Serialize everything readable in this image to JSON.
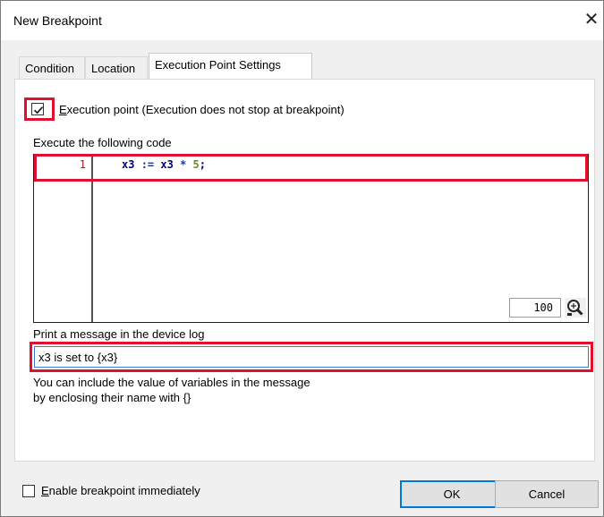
{
  "window": {
    "title": "New Breakpoint",
    "close_glyph": "✕"
  },
  "tabs": [
    {
      "label": "Condition",
      "active": false
    },
    {
      "label": "Location",
      "active": false
    },
    {
      "label": "Execution Point Settings",
      "active": true
    }
  ],
  "execution_point": {
    "checked": true,
    "label_first": "E",
    "label_rest": "xecution point (Execution does not stop at breakpoint)"
  },
  "code_section": {
    "label": "Execute the following code",
    "line_number": "1",
    "code_var": "x3",
    "code_op": ":=",
    "code_expr": "x3",
    "code_mul": "*",
    "code_num": "5",
    "code_end": ";",
    "zoom_value": "100",
    "zoom_icon": "magnifier-icon"
  },
  "log_section": {
    "label": "Print a message in the device log",
    "value": "x3 is set to {x3}",
    "hint_line1": "You can include the value of variables in the message",
    "hint_line2": "by enclosing their name with {}"
  },
  "footer": {
    "enable_checked": false,
    "enable_first": "E",
    "enable_rest": "nable breakpoint immediately",
    "ok_label": "OK",
    "cancel_label": "Cancel"
  },
  "colors": {
    "highlight": "#e0102e",
    "focus": "#3c78d8",
    "line_number": "#a0142a"
  }
}
